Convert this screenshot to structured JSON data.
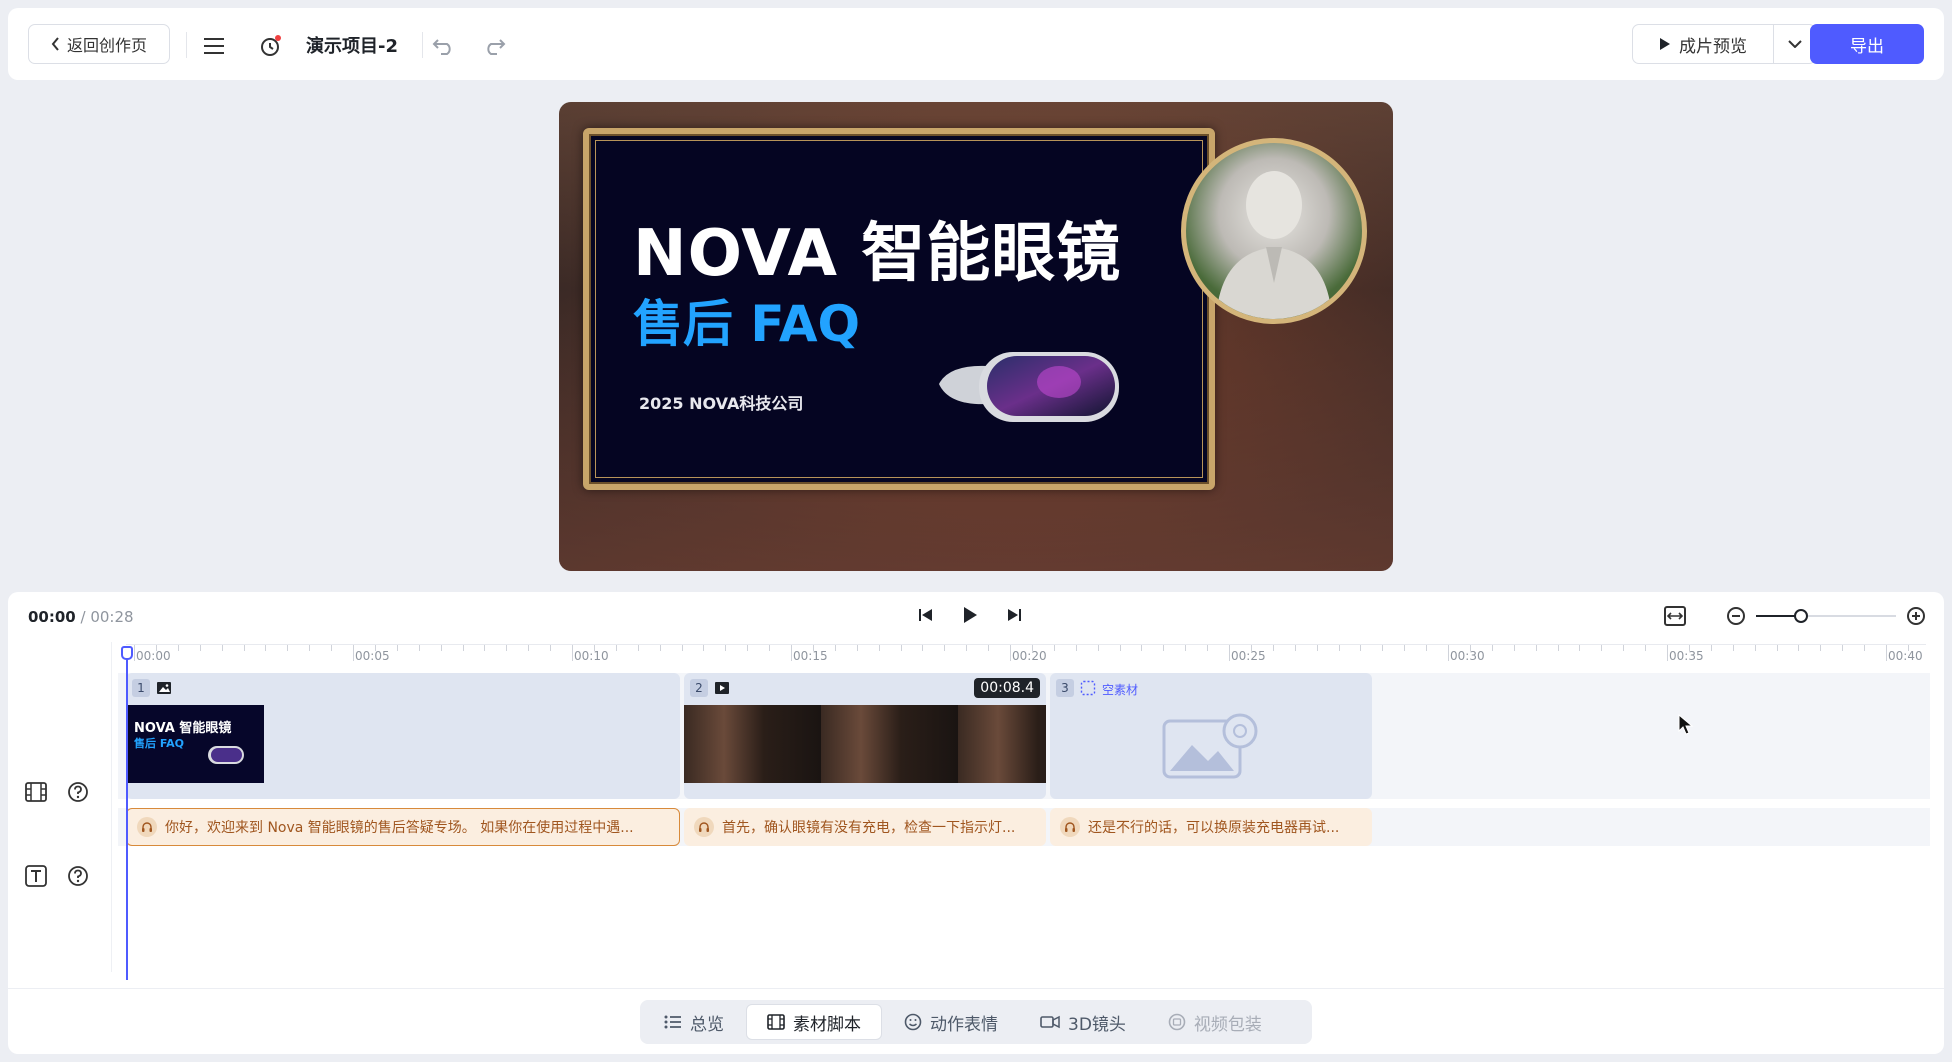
{
  "header": {
    "back_label": "返回创作页",
    "project_title": "演示项目-2",
    "preview_label": "成片预览",
    "export_label": "导出"
  },
  "canvas": {
    "slide_title_line1": "NOVA 智能眼镜",
    "slide_title_line2": "售后 FAQ",
    "slide_company": "2025 NOVA科技公司"
  },
  "player": {
    "current_time": "00:00",
    "separator": " / ",
    "total_time": "00:28"
  },
  "ruler": {
    "labels": [
      "00:00",
      "00:05",
      "00:10",
      "00:15",
      "00:20",
      "00:25",
      "00:30",
      "00:35",
      "00:40"
    ]
  },
  "clips": [
    {
      "number": "1",
      "type_icon": "image-icon",
      "thumb_title": "NOVA 智能眼镜",
      "thumb_subtitle": "售后 FAQ"
    },
    {
      "number": "2",
      "type_icon": "video-icon",
      "duration": "00:08.4"
    },
    {
      "number": "3",
      "type_icon": "empty-frame-icon",
      "label": "空素材"
    }
  ],
  "subtitles": [
    {
      "text": "你好，欢迎来到 Nova 智能眼镜的售后答疑专场。 如果你在使用过程中遇..."
    },
    {
      "text": "首先，确认眼镜有没有充电，检查一下指示灯..."
    },
    {
      "text": "还是不行的话，可以换原装充电器再试..."
    }
  ],
  "bottom_tabs": [
    {
      "label": "总览",
      "icon": "list-icon",
      "state": "normal"
    },
    {
      "label": "素材脚本",
      "icon": "film-icon",
      "state": "active"
    },
    {
      "label": "动作表情",
      "icon": "smile-icon",
      "state": "normal"
    },
    {
      "label": "3D镜头",
      "icon": "camera-icon",
      "state": "normal"
    },
    {
      "label": "视频包装",
      "icon": "package-icon",
      "state": "disabled"
    }
  ],
  "colors": {
    "accent": "#4f5bff",
    "subtitle_bg": "#fbeee0",
    "clip_bg": "#dfe5f1"
  }
}
